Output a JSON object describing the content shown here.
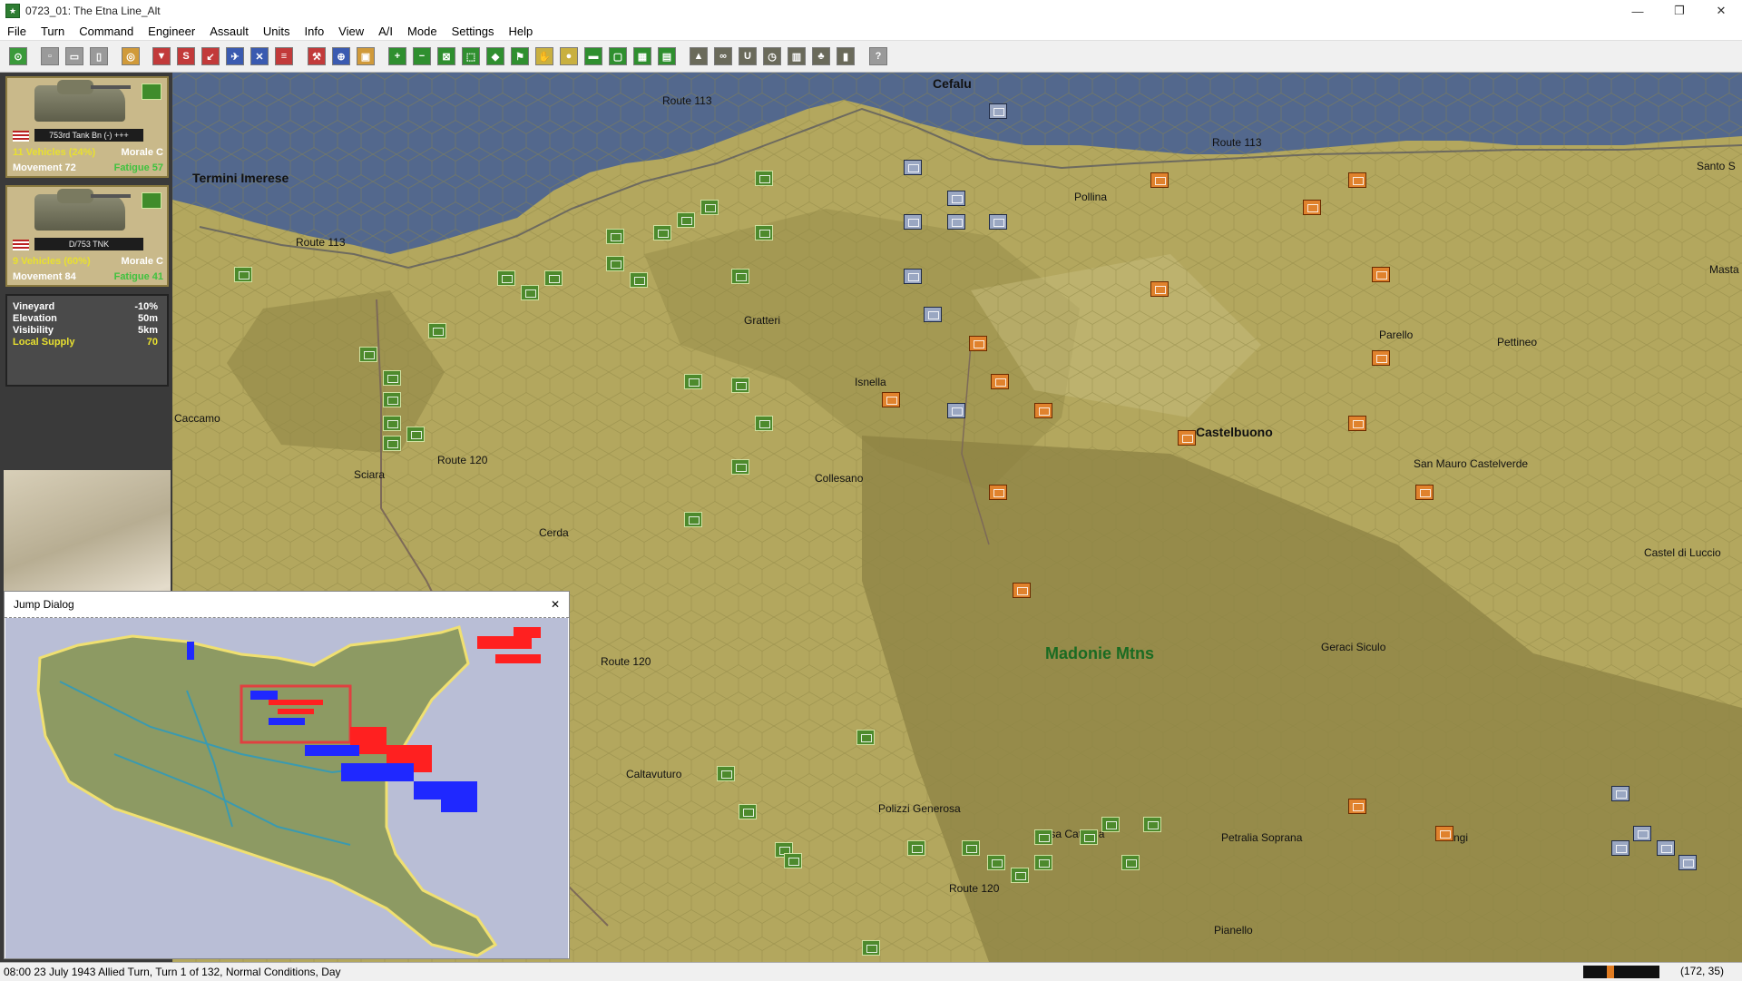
{
  "window": {
    "title": "0723_01: The Etna Line_Alt",
    "controls": [
      "—",
      "❐",
      "✕"
    ]
  },
  "menu": [
    "File",
    "Turn",
    "Command",
    "Engineer",
    "Assault",
    "Units",
    "Info",
    "View",
    "A/I",
    "Mode",
    "Settings",
    "Help"
  ],
  "units": [
    {
      "name": "753rd Tank Bn (-) +++",
      "vehicles": "11 Vehicles (24%)",
      "morale": "Morale C",
      "movement": "Movement 72",
      "fatigue": "Fatigue 57"
    },
    {
      "name": "D/753 TNK",
      "vehicles": "9 Vehicles (60%)",
      "morale": "Morale C",
      "movement": "Movement 84",
      "fatigue": "Fatigue 41"
    }
  ],
  "terrain_info": {
    "terrain": "Vineyard",
    "terrain_val": "-10%",
    "elevation": "Elevation",
    "elevation_val": "50m",
    "visibility": "Visibility",
    "visibility_val": "5km",
    "supply": "Local Supply",
    "supply_val": "70"
  },
  "map_labels": {
    "cefalu": "Cefalu",
    "route113_a": "Route 113",
    "route113_b": "Route 113",
    "route113_c": "Route 113",
    "santo": "Santo S",
    "termini": "Termini Imerese",
    "pollina": "Pollina",
    "masta": "Masta d",
    "gratteri": "Gratteri",
    "parello": "Parello",
    "pettineo": "Pettineo",
    "caccamo": "Caccamo",
    "isnella": "Isnella",
    "castelbuono": "Castelbuono",
    "sciara": "Sciara",
    "route120_a": "Route 120",
    "collesano": "Collesano",
    "san_mauro": "San Mauro Castelverde",
    "cerda": "Cerda",
    "castel_lucio": "Castel di Luccio",
    "madonie": "Madonie Mtns",
    "route120_b": "Route 120",
    "gerardi": "Geraci Siculo",
    "caltavuturo": "Caltavuturo",
    "polizzi": "Polizzi Generosa",
    "casa_catalina": "Casa Catalina",
    "petralia": "Petralia Soprana",
    "gangi": "Gangi",
    "route120_c": "Route 120",
    "pianello": "Pianello"
  },
  "jump_dialog": {
    "title": "Jump Dialog",
    "close": "✕"
  },
  "status": {
    "message": "08:00 23 July 1943 Allied Turn, Turn 1 of 132, Normal Conditions, Day",
    "coords": "(172, 35)"
  },
  "colors": {
    "allied": "#4d8a2d",
    "german": "#9aa7c2",
    "italian": "#e0822d",
    "sea": "#53688d"
  }
}
